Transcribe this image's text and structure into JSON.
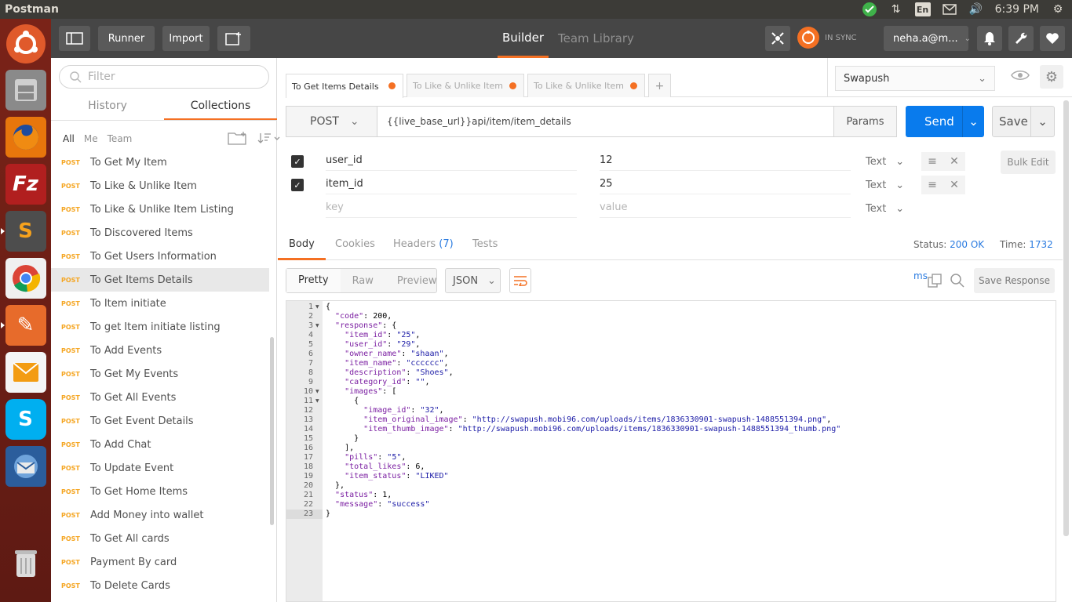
{
  "system": {
    "app_title": "Postman",
    "language": "En",
    "clock": "6:39 PM"
  },
  "launcher": {
    "items": [
      "ubuntu-icon",
      "files-icon",
      "firefox-icon",
      "filezilla-icon",
      "sublime-icon",
      "chrome-icon",
      "postman-icon",
      "mail-icon",
      "skype-icon",
      "thunderbird-icon",
      "trash-icon"
    ]
  },
  "header": {
    "runner_label": "Runner",
    "import_label": "Import",
    "tab_builder": "Builder",
    "tab_team_library": "Team Library",
    "sync_status": "IN SYNC",
    "user": "neha.a@m..."
  },
  "sidebar": {
    "filter_placeholder": "Filter",
    "tab_history": "History",
    "tab_collections": "Collections",
    "filter_all": "All",
    "filter_me": "Me",
    "filter_team": "Team",
    "items": [
      {
        "method": "POST",
        "name": "To Get My Item"
      },
      {
        "method": "POST",
        "name": "To Like & Unlike Item"
      },
      {
        "method": "POST",
        "name": "To Like & Unlike Item Listing"
      },
      {
        "method": "POST",
        "name": "To Discovered Items"
      },
      {
        "method": "POST",
        "name": "To Get Users Information"
      },
      {
        "method": "POST",
        "name": "To Get Items Details"
      },
      {
        "method": "POST",
        "name": "To Item initiate"
      },
      {
        "method": "POST",
        "name": "To get Item initiate listing"
      },
      {
        "method": "POST",
        "name": "To Add Events"
      },
      {
        "method": "POST",
        "name": "To Get My Events"
      },
      {
        "method": "POST",
        "name": "To Get All Events"
      },
      {
        "method": "POST",
        "name": "To Get Event Details"
      },
      {
        "method": "POST",
        "name": "To Add Chat"
      },
      {
        "method": "POST",
        "name": "To Update Event"
      },
      {
        "method": "POST",
        "name": "To Get Home Items"
      },
      {
        "method": "POST",
        "name": "Add Money into wallet"
      },
      {
        "method": "POST",
        "name": "To Get All cards"
      },
      {
        "method": "POST",
        "name": "Payment By card"
      },
      {
        "method": "POST",
        "name": "To Delete Cards"
      }
    ]
  },
  "request_tabs": [
    {
      "label": "To Get Items Details"
    },
    {
      "label": "To Like & Unlike Item"
    },
    {
      "label": "To Like & Unlike Item"
    }
  ],
  "environment": "Swapush",
  "request": {
    "method": "POST",
    "url": "{{live_base_url}}api/item/item_details",
    "params_label": "Params",
    "send_label": "Send",
    "save_label": "Save"
  },
  "params": {
    "rows": [
      {
        "key": "user_id",
        "value": "12",
        "type": "Text"
      },
      {
        "key": "item_id",
        "value": "25",
        "type": "Text"
      }
    ],
    "key_placeholder": "key",
    "value_placeholder": "value",
    "new_type": "Text",
    "bulk_edit": "Bulk Edit"
  },
  "response": {
    "tab_body": "Body",
    "tab_cookies": "Cookies",
    "tab_headers": "Headers",
    "headers_count": "(7)",
    "tab_tests": "Tests",
    "status_label": "Status:",
    "status_value": "200 OK",
    "time_label": "Time:",
    "time_value": "1732 ms",
    "view_pretty": "Pretty",
    "view_raw": "Raw",
    "view_preview": "Preview",
    "format": "JSON",
    "save_response": "Save Response",
    "lines": [
      "{",
      "  \"code\": 200,",
      "  \"response\": {",
      "    \"item_id\": \"25\",",
      "    \"user_id\": \"29\",",
      "    \"owner_name\": \"shaan\",",
      "    \"item_name\": \"cccccc\",",
      "    \"description\": \"Shoes\",",
      "    \"category_id\": \"\",",
      "    \"images\": [",
      "      {",
      "        \"image_id\": \"32\",",
      "        \"item_original_image\": \"http://swapush.mobi96.com/uploads/items/1836330901-swapush-1488551394.png\",",
      "        \"item_thumb_image\": \"http://swapush.mobi96.com/uploads/items/1836330901-swapush-1488551394_thumb.png\"",
      "      }",
      "    ],",
      "    \"pills\": \"5\",",
      "    \"total_likes\": 6,",
      "    \"item_status\": \"LIKED\"",
      "  },",
      "  \"status\": 1,",
      "  \"message\": \"success\"",
      "}"
    ]
  }
}
